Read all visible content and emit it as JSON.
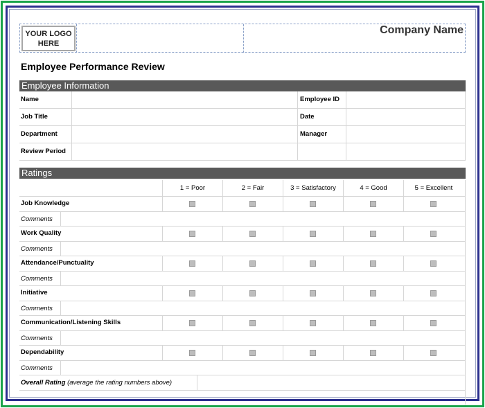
{
  "header": {
    "logo_line1": "YOUR LOGO",
    "logo_line2": "HERE",
    "company_name": "Company Name"
  },
  "title": "Employee Performance Review",
  "employee_info": {
    "section_title": "Employee Information",
    "left_labels": [
      "Name",
      "Job Title",
      "Department",
      "Review Period"
    ],
    "right_labels": [
      "Employee ID",
      "Date",
      "Manager",
      ""
    ]
  },
  "ratings": {
    "section_title": "Ratings",
    "scale": [
      "1 = Poor",
      "2 = Fair",
      "3 = Satisfactory",
      "4 = Good",
      "5 = Excellent"
    ],
    "criteria": [
      "Job Knowledge",
      "Work Quality",
      "Attendance/Punctuality",
      "Initiative",
      "Communication/Listening Skills",
      "Dependability"
    ],
    "comments_label": "Comments",
    "overall_label": "Overall Rating",
    "overall_note": "(average the rating numbers above)"
  }
}
